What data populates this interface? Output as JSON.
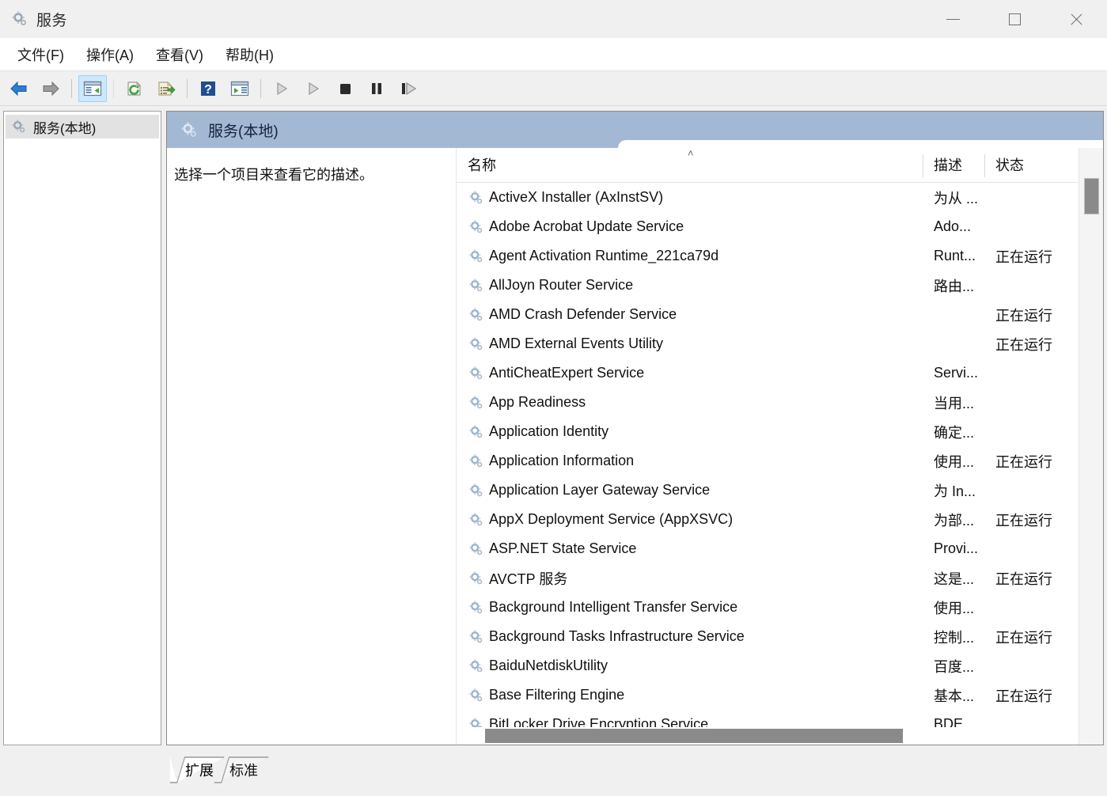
{
  "window": {
    "title": "服务",
    "icon": "services-gear-icon",
    "controls": {
      "minimize": "minimize-icon",
      "maximize": "maximize-icon",
      "close": "close-icon"
    }
  },
  "menubar": {
    "items": [
      {
        "label": "文件(F)",
        "name": "menu-file"
      },
      {
        "label": "操作(A)",
        "name": "menu-action"
      },
      {
        "label": "查看(V)",
        "name": "menu-view"
      },
      {
        "label": "帮助(H)",
        "name": "menu-help"
      }
    ]
  },
  "toolbar": {
    "buttons": [
      {
        "name": "back-button",
        "icon": "arrow-left-icon"
      },
      {
        "name": "forward-button",
        "icon": "arrow-right-icon"
      },
      {
        "name": "separator-1",
        "icon": "separator"
      },
      {
        "name": "show-console-tree-button",
        "icon": "console-tree-icon"
      },
      {
        "name": "separator-2",
        "icon": "separator-thin"
      },
      {
        "name": "refresh-button",
        "icon": "refresh-icon"
      },
      {
        "name": "export-list-button",
        "icon": "export-list-icon"
      },
      {
        "name": "separator-3",
        "icon": "separator"
      },
      {
        "name": "help-button",
        "icon": "help-question-icon"
      },
      {
        "name": "show-action-pane-button",
        "icon": "action-pane-icon"
      },
      {
        "name": "separator-4",
        "icon": "separator"
      },
      {
        "name": "start-service-button",
        "icon": "play-icon"
      },
      {
        "name": "resume-service-button",
        "icon": "play-icon"
      },
      {
        "name": "stop-service-button",
        "icon": "stop-square-icon"
      },
      {
        "name": "pause-service-button",
        "icon": "pause-bars-icon"
      },
      {
        "name": "restart-service-button",
        "icon": "restart-icon"
      }
    ]
  },
  "tree": {
    "items": [
      {
        "label": "服务(本地)",
        "icon": "services-gear-icon",
        "selected": true
      }
    ]
  },
  "pane": {
    "header_title": "服务(本地)",
    "header_icon": "services-gear-icon",
    "header_color": "#a3b8d3",
    "description_placeholder": "选择一个项目来查看它的描述。"
  },
  "list": {
    "columns": [
      {
        "key": "name",
        "label": "名称",
        "sorted": "ascending"
      },
      {
        "key": "description",
        "label": "描述"
      },
      {
        "key": "status",
        "label": "状态"
      }
    ],
    "sort_indicator": "˄",
    "rows": [
      {
        "name": "ActiveX Installer (AxInstSV)",
        "description": "为从 ...",
        "status": ""
      },
      {
        "name": "Adobe Acrobat Update Service",
        "description": "Ado...",
        "status": ""
      },
      {
        "name": "Agent Activation Runtime_221ca79d",
        "description": "Runt...",
        "status": "正在运行"
      },
      {
        "name": "AllJoyn Router Service",
        "description": "路由...",
        "status": ""
      },
      {
        "name": "AMD Crash Defender Service",
        "description": "",
        "status": "正在运行"
      },
      {
        "name": "AMD External Events Utility",
        "description": "",
        "status": "正在运行"
      },
      {
        "name": "AntiCheatExpert Service",
        "description": "Servi...",
        "status": ""
      },
      {
        "name": "App Readiness",
        "description": "当用...",
        "status": ""
      },
      {
        "name": "Application Identity",
        "description": "确定...",
        "status": ""
      },
      {
        "name": "Application Information",
        "description": "使用...",
        "status": "正在运行"
      },
      {
        "name": "Application Layer Gateway Service",
        "description": "为 In...",
        "status": ""
      },
      {
        "name": "AppX Deployment Service (AppXSVC)",
        "description": "为部...",
        "status": "正在运行"
      },
      {
        "name": "ASP.NET State Service",
        "description": "Provi...",
        "status": ""
      },
      {
        "name": "AVCTP 服务",
        "description": "这是...",
        "status": "正在运行"
      },
      {
        "name": "Background Intelligent Transfer Service",
        "description": "使用...",
        "status": ""
      },
      {
        "name": "Background Tasks Infrastructure Service",
        "description": "控制...",
        "status": "正在运行"
      },
      {
        "name": "BaiduNetdiskUtility",
        "description": "百度...",
        "status": ""
      },
      {
        "name": "Base Filtering Engine",
        "description": "基本...",
        "status": "正在运行"
      },
      {
        "name": "BitLocker Drive Encryption Service",
        "description": "BDE...",
        "status": ""
      }
    ],
    "row_icon": "service-gear-icon"
  },
  "tabs": {
    "items": [
      {
        "label": "扩展",
        "name": "tab-extended",
        "active": true
      },
      {
        "label": "标准",
        "name": "tab-standard",
        "active": false
      }
    ]
  }
}
